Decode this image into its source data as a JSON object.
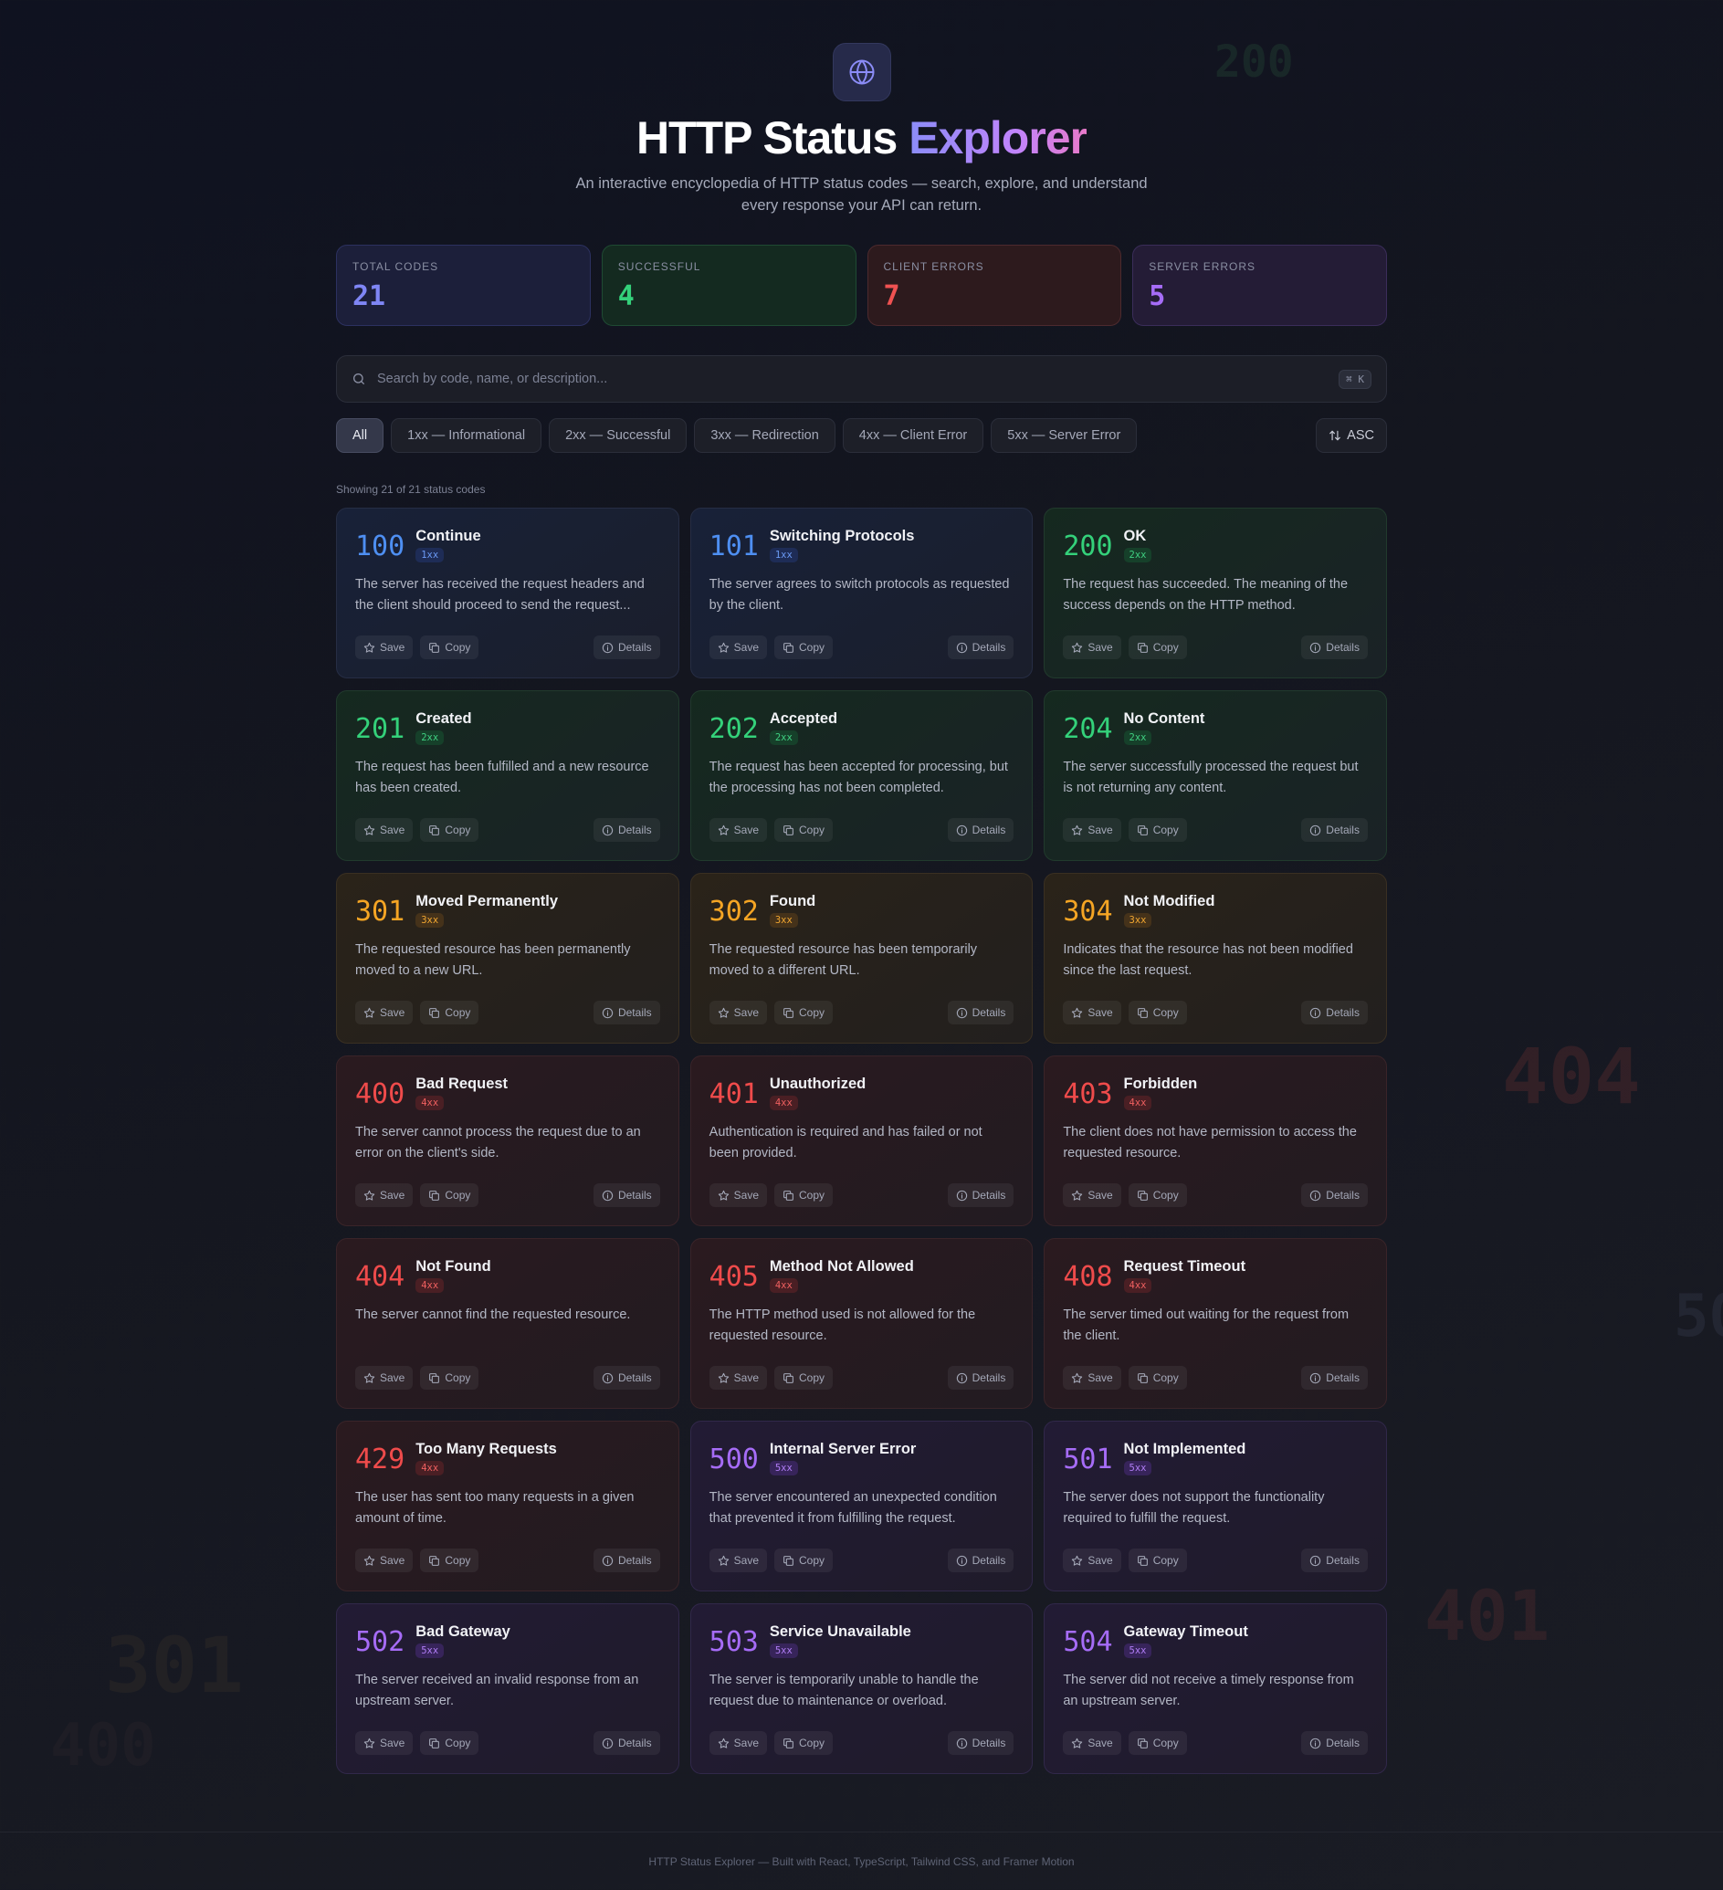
{
  "app": {
    "title_main": "HTTP Status",
    "title_accent": "Explorer",
    "subtitle": "An interactive encyclopedia of HTTP status codes — search, explore, and understand every response your API can return.",
    "logo_icon": "globe-icon"
  },
  "stats": {
    "total": {
      "label": "Total Codes",
      "value": "21",
      "color": "#7f86f5"
    },
    "successful": {
      "label": "Successful",
      "value": "4",
      "color": "#34d17a"
    },
    "client": {
      "label": "Client Errors",
      "value": "7",
      "color": "#f05252"
    },
    "server": {
      "label": "Server Errors",
      "value": "5",
      "color": "#a66cf7"
    }
  },
  "search": {
    "placeholder": "Search by code, name, or description...",
    "value": "",
    "shortcut": "⌘ K"
  },
  "filters": {
    "items": [
      "All",
      "1xx — Informational",
      "2xx — Successful",
      "3xx — Redirection",
      "4xx — Client Error",
      "5xx — Server Error"
    ],
    "active": "All",
    "sort_label": "ASC"
  },
  "showing_text": "Showing 21 of 21 status codes",
  "actions": {
    "save": "Save",
    "copy": "Copy",
    "details": "Details"
  },
  "cards": [
    {
      "code": "100",
      "name": "Continue",
      "cls": "1xx",
      "desc": "The server has received the request headers and the client should proceed to send the request..."
    },
    {
      "code": "101",
      "name": "Switching Protocols",
      "cls": "1xx",
      "desc": "The server agrees to switch protocols as requested by the client."
    },
    {
      "code": "200",
      "name": "OK",
      "cls": "2xx",
      "desc": "The request has succeeded. The meaning of the success depends on the HTTP method."
    },
    {
      "code": "201",
      "name": "Created",
      "cls": "2xx",
      "desc": "The request has been fulfilled and a new resource has been created."
    },
    {
      "code": "202",
      "name": "Accepted",
      "cls": "2xx",
      "desc": "The request has been accepted for processing, but the processing has not been completed."
    },
    {
      "code": "204",
      "name": "No Content",
      "cls": "2xx",
      "desc": "The server successfully processed the request but is not returning any content."
    },
    {
      "code": "301",
      "name": "Moved Permanently",
      "cls": "3xx",
      "desc": "The requested resource has been permanently moved to a new URL."
    },
    {
      "code": "302",
      "name": "Found",
      "cls": "3xx",
      "desc": "The requested resource has been temporarily moved to a different URL."
    },
    {
      "code": "304",
      "name": "Not Modified",
      "cls": "3xx",
      "desc": "Indicates that the resource has not been modified since the last request."
    },
    {
      "code": "400",
      "name": "Bad Request",
      "cls": "4xx",
      "desc": "The server cannot process the request due to an error on the client's side."
    },
    {
      "code": "401",
      "name": "Unauthorized",
      "cls": "4xx",
      "desc": "Authentication is required and has failed or not been provided."
    },
    {
      "code": "403",
      "name": "Forbidden",
      "cls": "4xx",
      "desc": "The client does not have permission to access the requested resource."
    },
    {
      "code": "404",
      "name": "Not Found",
      "cls": "4xx",
      "desc": "The server cannot find the requested resource."
    },
    {
      "code": "405",
      "name": "Method Not Allowed",
      "cls": "4xx",
      "desc": "The HTTP method used is not allowed for the requested resource."
    },
    {
      "code": "408",
      "name": "Request Timeout",
      "cls": "4xx",
      "desc": "The server timed out waiting for the request from the client."
    },
    {
      "code": "429",
      "name": "Too Many Requests",
      "cls": "4xx",
      "desc": "The user has sent too many requests in a given amount of time."
    },
    {
      "code": "500",
      "name": "Internal Server Error",
      "cls": "5xx",
      "desc": "The server encountered an unexpected condition that prevented it from fulfilling the request."
    },
    {
      "code": "501",
      "name": "Not Implemented",
      "cls": "5xx",
      "desc": "The server does not support the functionality required to fulfill the request."
    },
    {
      "code": "502",
      "name": "Bad Gateway",
      "cls": "5xx",
      "desc": "The server received an invalid response from an upstream server."
    },
    {
      "code": "503",
      "name": "Service Unavailable",
      "cls": "5xx",
      "desc": "The server is temporarily unable to handle the request due to maintenance or overload."
    },
    {
      "code": "504",
      "name": "Gateway Timeout",
      "cls": "5xx",
      "desc": "The server did not receive a timely response from an upstream server."
    }
  ],
  "background_numbers": [
    "200",
    "404",
    "50",
    "401",
    "301",
    "400"
  ],
  "footer": "HTTP Status Explorer — Built with React, TypeScript, Tailwind CSS, and Framer Motion"
}
